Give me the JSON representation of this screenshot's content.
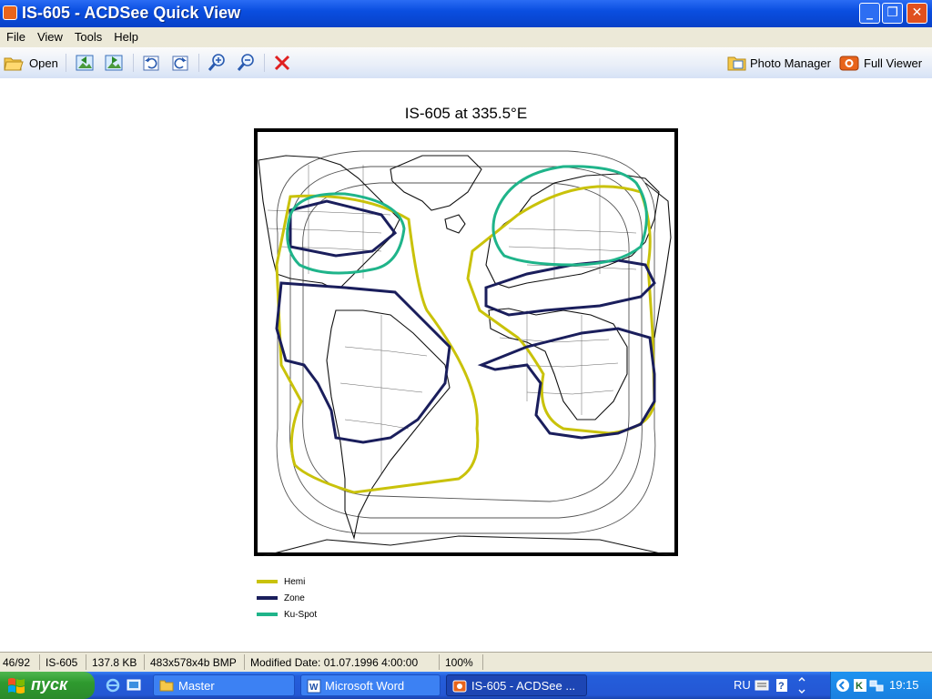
{
  "window": {
    "title": "IS-605 - ACDSee Quick View"
  },
  "menu": [
    "File",
    "View",
    "Tools",
    "Help"
  ],
  "toolbar": {
    "open_label": "Open",
    "photo_manager_label": "Photo Manager",
    "full_viewer_label": "Full Viewer"
  },
  "image": {
    "title": "IS-605 at 335.5°E",
    "legend": [
      {
        "label": "Hemi",
        "color": "#c9c20a"
      },
      {
        "label": "Zone",
        "color": "#1a1e5c"
      },
      {
        "label": "Ku-Spot",
        "color": "#1fb48a"
      }
    ]
  },
  "status": {
    "index": "46/92",
    "name": "IS-605",
    "size": "137.8 KB",
    "dims": "483x578x4b BMP",
    "modified": "Modified Date: 01.07.1996 4:00:00",
    "zoom": "100%"
  },
  "taskbar": {
    "start_label": "пуск",
    "tasks": [
      "Master",
      "Microsoft Word",
      "IS-605 - ACDSee ..."
    ],
    "lang": "RU",
    "clock": "19:15"
  },
  "colors": {
    "title_blue": "#0a4ee0",
    "hemi": "#c9c20a",
    "zone": "#1a1e5c",
    "spot": "#1fb48a"
  }
}
